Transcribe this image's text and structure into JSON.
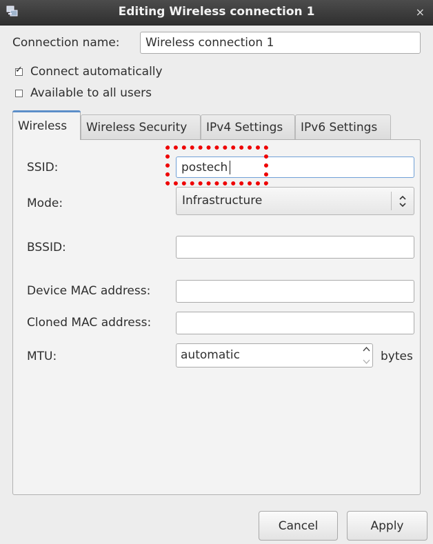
{
  "window": {
    "title": "Editing Wireless connection 1",
    "close_glyph": "×",
    "app_icon": "network-icon"
  },
  "connection": {
    "name_label": "Connection name:",
    "name_value": "Wireless connection 1",
    "connect_auto_label": "Connect automatically",
    "connect_auto_checked": true,
    "all_users_label": "Available to all users",
    "all_users_checked": false
  },
  "tabs": [
    {
      "label": "Wireless",
      "active": true
    },
    {
      "label": "Wireless Security",
      "active": false
    },
    {
      "label": "IPv4 Settings",
      "active": false
    },
    {
      "label": "IPv6 Settings",
      "active": false
    }
  ],
  "wireless": {
    "ssid_label": "SSID:",
    "ssid_value": "postech",
    "mode_label": "Mode:",
    "mode_value": "Infrastructure",
    "bssid_label": "BSSID:",
    "bssid_value": "",
    "device_mac_label": "Device MAC address:",
    "device_mac_value": "",
    "cloned_mac_label": "Cloned MAC address:",
    "cloned_mac_value": "",
    "mtu_label": "MTU:",
    "mtu_value": "automatic",
    "mtu_unit": "bytes"
  },
  "buttons": {
    "cancel": "Cancel",
    "apply": "Apply"
  },
  "colors": {
    "annotation": "#ee0000",
    "tab_accent": "#5b8ec9",
    "titlebar": "#3a3a3a"
  }
}
